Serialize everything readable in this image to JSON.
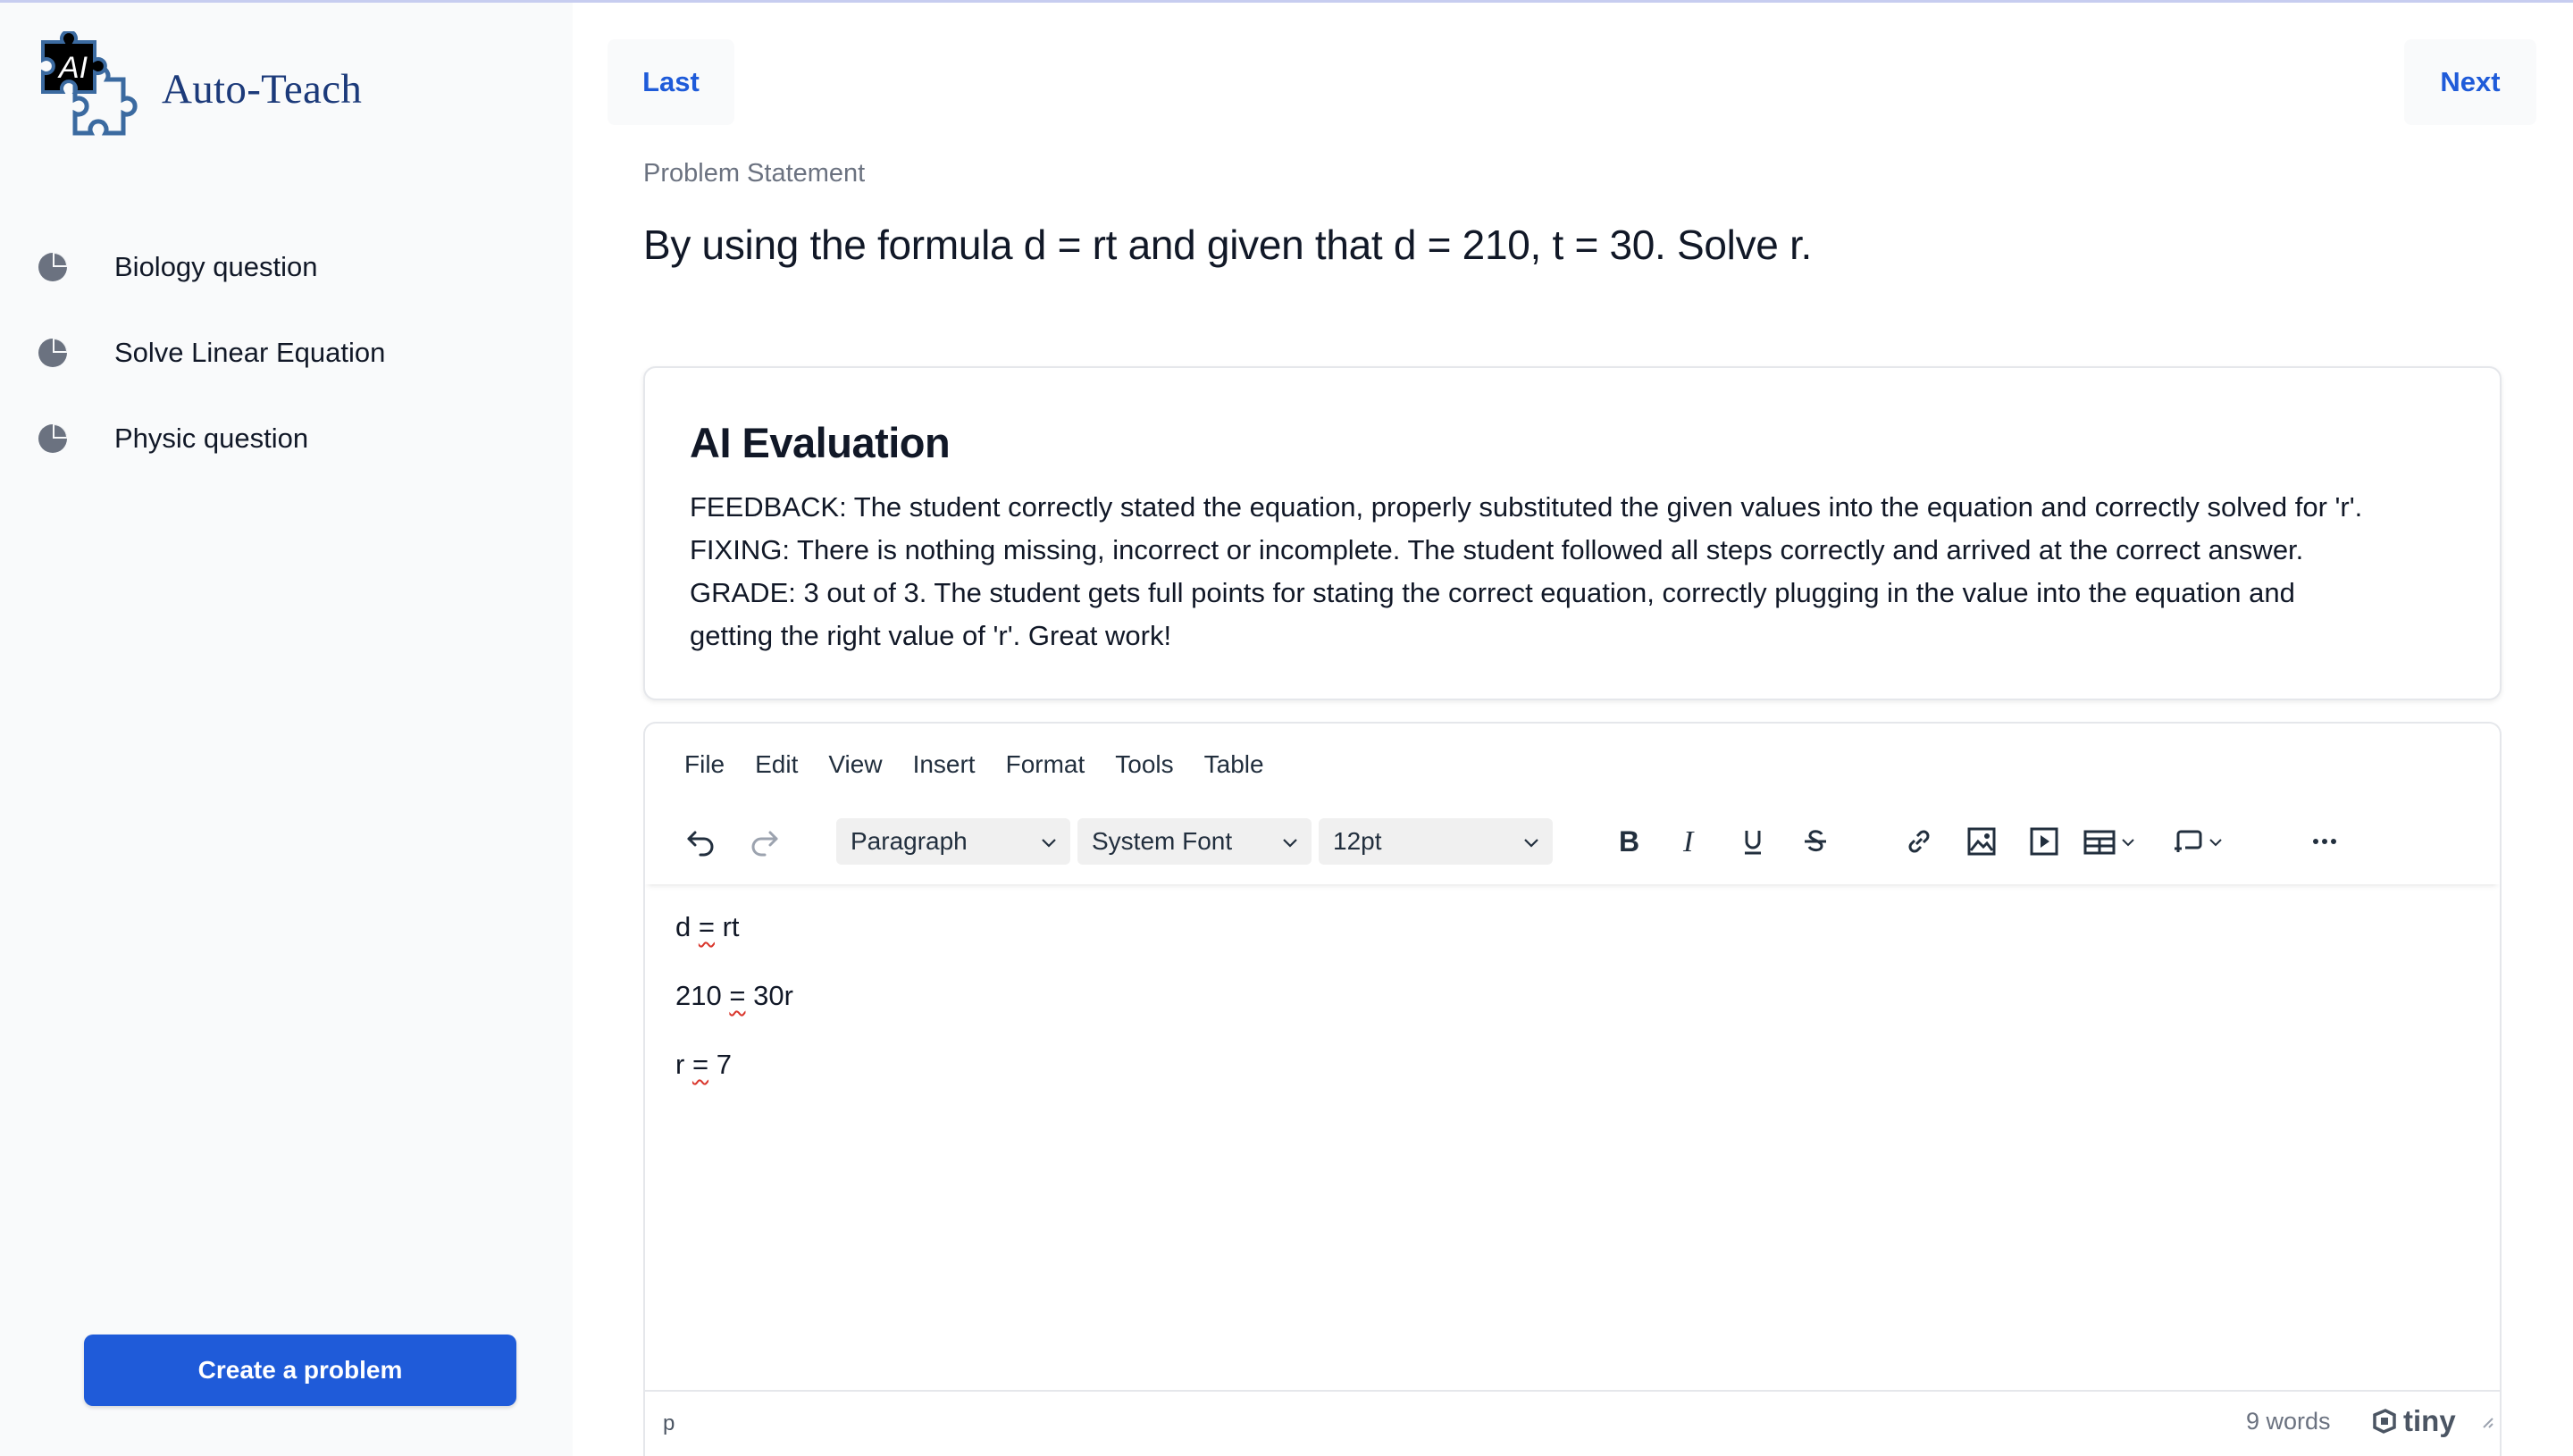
{
  "app": {
    "logo_text": "Auto-Teach",
    "logo_badge": "AI",
    "brand_color": "#1f5bd9"
  },
  "sidebar": {
    "items": [
      {
        "label": "Biology question",
        "icon": "pie-chart-icon"
      },
      {
        "label": "Solve Linear Equation",
        "icon": "pie-chart-icon"
      },
      {
        "label": "Physic question",
        "icon": "pie-chart-icon"
      }
    ],
    "create_button": "Create a problem"
  },
  "navigation": {
    "last_label": "Last",
    "next_label": "Next"
  },
  "problem": {
    "label": "Problem Statement",
    "statement": "By using the formula d = rt and given that d = 210, t = 30. Solve r."
  },
  "evaluation": {
    "title": "AI Evaluation",
    "lines": [
      "FEEDBACK: The student correctly stated the equation, properly substituted the given values into the equation and correctly solved for 'r'.",
      "FIXING: There is nothing missing, incorrect or incomplete. The student followed all steps correctly and arrived at the correct answer.",
      "GRADE: 3 out of 3. The student gets full points for stating the correct equation, correctly plugging in the value into the equation and",
      "getting the right value of 'r'. Great work!"
    ]
  },
  "editor": {
    "menu": [
      "File",
      "Edit",
      "View",
      "Insert",
      "Format",
      "Tools",
      "Table"
    ],
    "block_format": "Paragraph",
    "font_family": "System Font",
    "font_size": "12pt",
    "content": [
      {
        "left": "d",
        "op": "=",
        "right": "rt"
      },
      {
        "left": "210",
        "op": "=",
        "right": "30r"
      },
      {
        "left": "r",
        "op": "=",
        "right": "7"
      }
    ],
    "status_path": "p",
    "word_count": "9 words",
    "brand": "tiny"
  }
}
